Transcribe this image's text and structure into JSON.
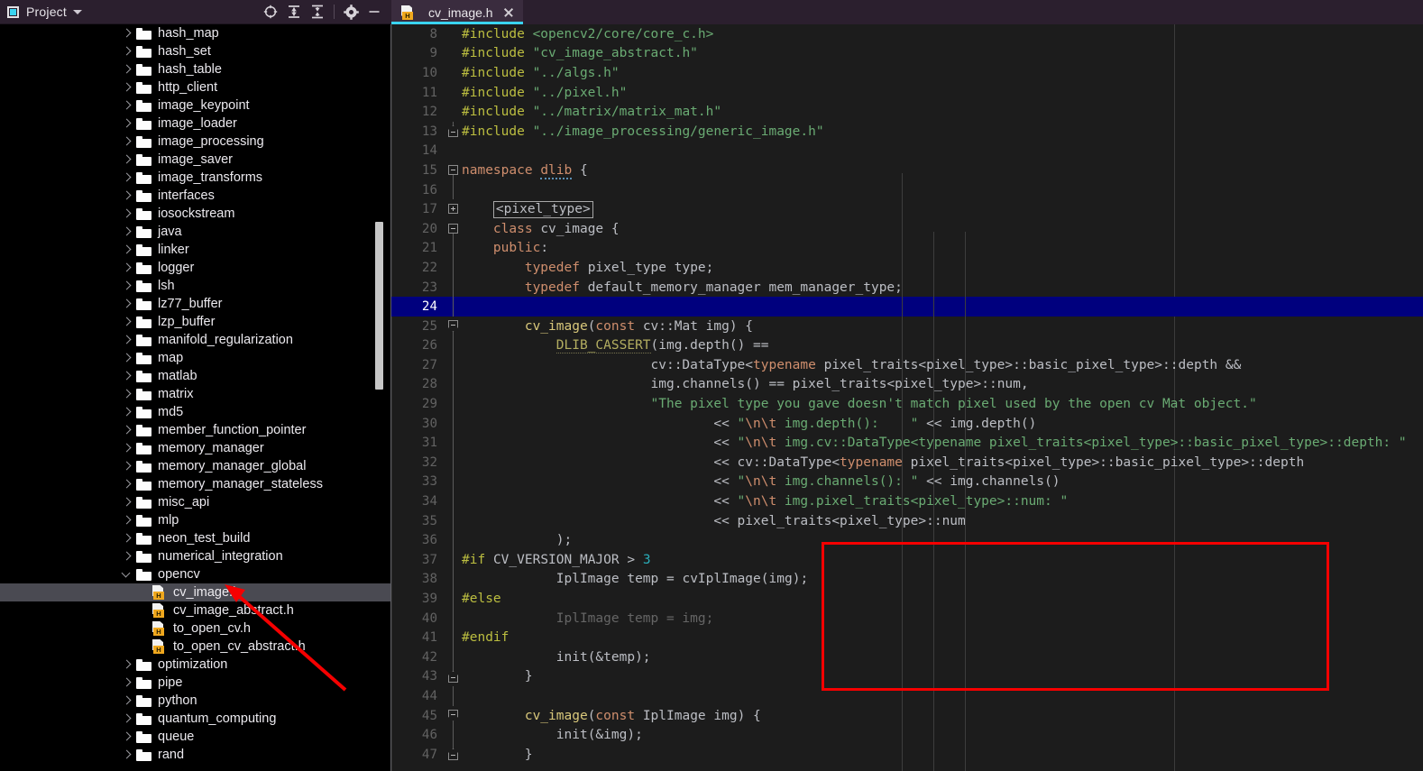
{
  "project_panel": {
    "title": "Project",
    "icons": [
      "project-icon",
      "chevron-down-icon",
      "locate-target-icon",
      "expand-all-icon",
      "collapse-all-icon",
      "settings-gear-icon",
      "minimize-icon"
    ],
    "tree": [
      {
        "label": "hash_map",
        "type": "folder",
        "state": "collapsed",
        "depth": 0
      },
      {
        "label": "hash_set",
        "type": "folder",
        "state": "collapsed",
        "depth": 0
      },
      {
        "label": "hash_table",
        "type": "folder",
        "state": "collapsed",
        "depth": 0
      },
      {
        "label": "http_client",
        "type": "folder",
        "state": "collapsed",
        "depth": 0
      },
      {
        "label": "image_keypoint",
        "type": "folder",
        "state": "collapsed",
        "depth": 0
      },
      {
        "label": "image_loader",
        "type": "folder",
        "state": "collapsed",
        "depth": 0
      },
      {
        "label": "image_processing",
        "type": "folder",
        "state": "collapsed",
        "depth": 0
      },
      {
        "label": "image_saver",
        "type": "folder",
        "state": "collapsed",
        "depth": 0
      },
      {
        "label": "image_transforms",
        "type": "folder",
        "state": "collapsed",
        "depth": 0
      },
      {
        "label": "interfaces",
        "type": "folder",
        "state": "collapsed",
        "depth": 0
      },
      {
        "label": "iosockstream",
        "type": "folder",
        "state": "collapsed",
        "depth": 0
      },
      {
        "label": "java",
        "type": "folder",
        "state": "collapsed",
        "depth": 0
      },
      {
        "label": "linker",
        "type": "folder",
        "state": "collapsed",
        "depth": 0
      },
      {
        "label": "logger",
        "type": "folder",
        "state": "collapsed",
        "depth": 0
      },
      {
        "label": "lsh",
        "type": "folder",
        "state": "collapsed",
        "depth": 0
      },
      {
        "label": "lz77_buffer",
        "type": "folder",
        "state": "collapsed",
        "depth": 0
      },
      {
        "label": "lzp_buffer",
        "type": "folder",
        "state": "collapsed",
        "depth": 0
      },
      {
        "label": "manifold_regularization",
        "type": "folder",
        "state": "collapsed",
        "depth": 0
      },
      {
        "label": "map",
        "type": "folder",
        "state": "collapsed",
        "depth": 0
      },
      {
        "label": "matlab",
        "type": "folder",
        "state": "collapsed",
        "depth": 0
      },
      {
        "label": "matrix",
        "type": "folder",
        "state": "collapsed",
        "depth": 0
      },
      {
        "label": "md5",
        "type": "folder",
        "state": "collapsed",
        "depth": 0
      },
      {
        "label": "member_function_pointer",
        "type": "folder",
        "state": "collapsed",
        "depth": 0
      },
      {
        "label": "memory_manager",
        "type": "folder",
        "state": "collapsed",
        "depth": 0
      },
      {
        "label": "memory_manager_global",
        "type": "folder",
        "state": "collapsed",
        "depth": 0
      },
      {
        "label": "memory_manager_stateless",
        "type": "folder",
        "state": "collapsed",
        "depth": 0
      },
      {
        "label": "misc_api",
        "type": "folder",
        "state": "collapsed",
        "depth": 0
      },
      {
        "label": "mlp",
        "type": "folder",
        "state": "collapsed",
        "depth": 0
      },
      {
        "label": "neon_test_build",
        "type": "folder",
        "state": "collapsed",
        "depth": 0
      },
      {
        "label": "numerical_integration",
        "type": "folder",
        "state": "collapsed",
        "depth": 0
      },
      {
        "label": "opencv",
        "type": "folder",
        "state": "expanded",
        "depth": 0
      },
      {
        "label": "cv_image.h",
        "type": "header-file",
        "state": "selected",
        "depth": 1
      },
      {
        "label": "cv_image_abstract.h",
        "type": "header-file",
        "state": "normal",
        "depth": 1
      },
      {
        "label": "to_open_cv.h",
        "type": "header-file",
        "state": "normal",
        "depth": 1
      },
      {
        "label": "to_open_cv_abstract.h",
        "type": "header-file",
        "state": "normal",
        "depth": 1
      },
      {
        "label": "optimization",
        "type": "folder",
        "state": "collapsed",
        "depth": 0
      },
      {
        "label": "pipe",
        "type": "folder",
        "state": "collapsed",
        "depth": 0
      },
      {
        "label": "python",
        "type": "folder",
        "state": "collapsed",
        "depth": 0
      },
      {
        "label": "quantum_computing",
        "type": "folder",
        "state": "collapsed",
        "depth": 0
      },
      {
        "label": "queue",
        "type": "folder",
        "state": "collapsed",
        "depth": 0
      },
      {
        "label": "rand",
        "type": "folder",
        "state": "collapsed",
        "depth": 0
      }
    ]
  },
  "editor": {
    "tab": {
      "label": "cv_image.h",
      "icon": "header-file-icon",
      "close_icon": "close-icon",
      "active": true
    },
    "current_line": 24,
    "lines": [
      {
        "n": "8",
        "fold": "",
        "html": "<span class=\"pre\">#include</span> <span class=\"str\">&lt;opencv2/core/core_c.h&gt;</span>",
        "indent": 0
      },
      {
        "n": "9",
        "fold": "",
        "html": "<span class=\"pre\">#include</span> <span class=\"str\">\"cv_image_abstract.h\"</span>",
        "indent": 0
      },
      {
        "n": "10",
        "fold": "",
        "html": "<span class=\"pre\">#include</span> <span class=\"str\">\"../algs.h\"</span>",
        "indent": 0
      },
      {
        "n": "11",
        "fold": "",
        "html": "<span class=\"pre\">#include</span> <span class=\"str\">\"../pixel.h\"</span>",
        "indent": 0
      },
      {
        "n": "12",
        "fold": "",
        "html": "<span class=\"pre\">#include</span> <span class=\"str\">\"../matrix/matrix_mat.h\"</span>",
        "indent": 0
      },
      {
        "n": "13",
        "fold": "arrow-end",
        "html": "<span class=\"pre\">#include</span> <span class=\"str\">\"../image_processing/generic_image.h\"</span>",
        "indent": 0
      },
      {
        "n": "14",
        "fold": "",
        "html": "",
        "indent": 0
      },
      {
        "n": "15",
        "fold": "minus",
        "html": "<span class=\"kw\">namespace</span> <span class=\"ns-und\">dlib</span> {",
        "indent": 0
      },
      {
        "n": "16",
        "fold": "line",
        "html": "",
        "indent": 0
      },
      {
        "n": "17",
        "fold": "plus",
        "html": "    <span class=\"tmplbox\">&lt;pixel_type&gt;</span>",
        "indent": 0
      },
      {
        "n": "20",
        "fold": "minus",
        "html": "    <span class=\"kw\">class</span> <span class=\"ident\">cv_image</span> {",
        "indent": 0
      },
      {
        "n": "21",
        "fold": "line",
        "html": "    <span class=\"kw\">public</span>:",
        "indent": 0
      },
      {
        "n": "22",
        "fold": "line",
        "html": "        <span class=\"kw\">typedef</span> <span class=\"ident\">pixel_type</span> <span class=\"ident\">type</span>;",
        "indent": 0
      },
      {
        "n": "23",
        "fold": "line",
        "html": "        <span class=\"kw\">typedef</span> <span class=\"ident\">default_memory_manager</span> <span class=\"ident\">mem_manager_type</span>;",
        "indent": 0
      },
      {
        "n": "24",
        "fold": "line",
        "html": "",
        "indent": 0,
        "current": true
      },
      {
        "n": "25",
        "fold": "arrow",
        "html": "        <span class=\"fn\">cv_image</span>(<span class=\"kw\">const</span> <span class=\"ident\">cv::Mat img</span>) {",
        "indent": 0
      },
      {
        "n": "26",
        "fold": "line",
        "html": "            <span class=\"macro\">DLIB_CASSERT</span>(<span class=\"ident\">img.depth</span>() ==",
        "indent": 0
      },
      {
        "n": "27",
        "fold": "line",
        "html": "                        <span class=\"ident\">cv::DataType</span>&lt;<span class=\"kw\">typename</span> <span class=\"ident\">pixel_traits</span>&lt;<span class=\"ident\">pixel_type</span>&gt;::<span class=\"ident\">basic_pixel_type</span>&gt;::<span class=\"ident\">depth</span> &amp;&amp;",
        "indent": 0
      },
      {
        "n": "28",
        "fold": "line",
        "html": "                        <span class=\"ident\">img.channels</span>() == <span class=\"ident\">pixel_traits</span>&lt;<span class=\"ident\">pixel_type</span>&gt;::<span class=\"ident\">num</span>,",
        "indent": 0
      },
      {
        "n": "29",
        "fold": "line",
        "html": "                        <span class=\"str\">\"The pixel type you gave doesn't match pixel used by the open cv Mat object.\"</span>",
        "indent": 0
      },
      {
        "n": "30",
        "fold": "line",
        "html": "                                &lt;&lt; <span class=\"str\">\"</span><span class=\"esc\">\\n\\t</span><span class=\"str\"> img.depth():    \"</span> &lt;&lt; <span class=\"ident\">img.depth</span>()",
        "indent": 0
      },
      {
        "n": "31",
        "fold": "line",
        "html": "                                &lt;&lt; <span class=\"str\">\"</span><span class=\"esc\">\\n\\t</span><span class=\"str\"> img.cv::DataType&lt;typename pixel_traits&lt;pixel_type&gt;::basic_pixel_type&gt;::depth: \"</span>",
        "indent": 0
      },
      {
        "n": "32",
        "fold": "line",
        "html": "                                &lt;&lt; <span class=\"ident\">cv::DataType</span>&lt;<span class=\"kw\">typename</span> <span class=\"ident\">pixel_traits</span>&lt;<span class=\"ident\">pixel_type</span>&gt;::<span class=\"ident\">basic_pixel_type</span>&gt;::<span class=\"ident\">depth</span>",
        "indent": 0
      },
      {
        "n": "33",
        "fold": "line",
        "html": "                                &lt;&lt; <span class=\"str\">\"</span><span class=\"esc\">\\n\\t</span><span class=\"str\"> img.channels(): \"</span> &lt;&lt; <span class=\"ident\">img.channels</span>()",
        "indent": 0
      },
      {
        "n": "34",
        "fold": "line",
        "html": "                                &lt;&lt; <span class=\"str\">\"</span><span class=\"esc\">\\n\\t</span><span class=\"str\"> img.pixel_traits&lt;pixel_type&gt;::num: \"</span>",
        "indent": 0
      },
      {
        "n": "35",
        "fold": "line",
        "html": "                                &lt;&lt; <span class=\"ident\">pixel_traits</span>&lt;<span class=\"ident\">pixel_type</span>&gt;::<span class=\"ident\">num</span>",
        "indent": 0
      },
      {
        "n": "36",
        "fold": "line",
        "html": "            );",
        "indent": 0
      },
      {
        "n": "37",
        "fold": "line",
        "html": "<span class=\"pre\">#if</span> <span class=\"ident\">CV_VERSION_MAJOR</span> &gt; <span class=\"num\">3</span>",
        "indent": 0
      },
      {
        "n": "38",
        "fold": "line",
        "html": "            <span class=\"ident\">IplImage temp</span> = <span class=\"ident\">cvIplImage</span>(<span class=\"ident\">img</span>);",
        "indent": 0
      },
      {
        "n": "39",
        "fold": "line",
        "html": "<span class=\"pre\">#else</span>",
        "indent": 0
      },
      {
        "n": "40",
        "fold": "line",
        "html": "<span class=\"inactive\">            IplImage temp = img;</span>",
        "indent": 0
      },
      {
        "n": "41",
        "fold": "line",
        "html": "<span class=\"pre\">#endif</span>",
        "indent": 0
      },
      {
        "n": "42",
        "fold": "line",
        "html": "            <span class=\"ident\">init</span>(&amp;<span class=\"ident\">temp</span>);",
        "indent": 0
      },
      {
        "n": "43",
        "fold": "arrow-end",
        "html": "        }",
        "indent": 0
      },
      {
        "n": "44",
        "fold": "line",
        "html": "",
        "indent": 0
      },
      {
        "n": "45",
        "fold": "arrow",
        "html": "        <span class=\"fn\">cv_image</span>(<span class=\"kw\">const</span> <span class=\"ident\">IplImage img</span>) {",
        "indent": 0
      },
      {
        "n": "46",
        "fold": "line",
        "html": "            <span class=\"ident\">init</span>(&amp;<span class=\"ident\">img</span>);",
        "indent": 0
      },
      {
        "n": "47",
        "fold": "arrow-end",
        "html": "        }",
        "indent": 0
      }
    ]
  },
  "annotations": {
    "red_box": {
      "color": "#f50000",
      "surrounds_lines": "36-43"
    },
    "red_arrow": {
      "color": "#f50000",
      "points_to": "cv_image.h"
    }
  },
  "colors": {
    "accent_cyan": "#3ad4f0",
    "panel_header": "#2b1f2e",
    "editor_bg": "#1c1c1c",
    "current_line": "#00007e",
    "selection": "#4a4a52",
    "annotation_red": "#f50000",
    "keyword": "#cf8e6d",
    "string": "#6aab73",
    "preprocessor": "#bcbe40",
    "number": "#2aacb8"
  }
}
